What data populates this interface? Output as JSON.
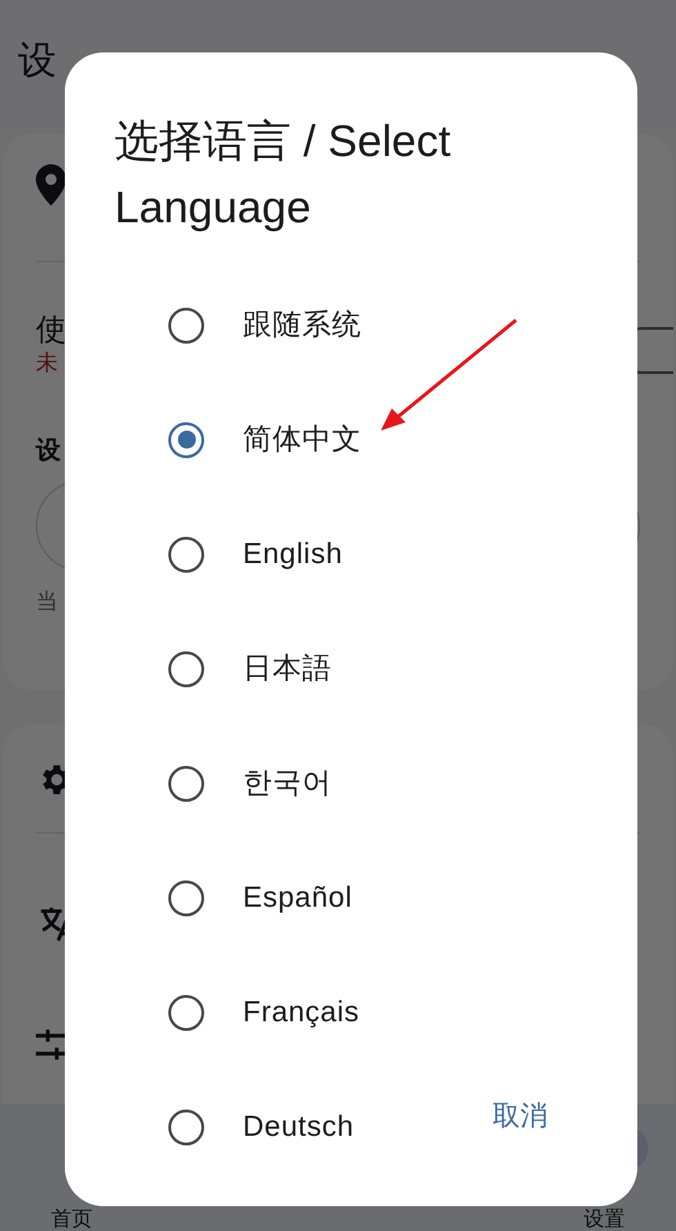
{
  "background": {
    "title": "设",
    "row_label": "使",
    "status_text": "未",
    "toggle_on": false,
    "section_label": "设",
    "current_text": "当",
    "nav_items": [
      {
        "label": "首页",
        "selected": false
      },
      {
        "label": "设置",
        "selected": true
      }
    ]
  },
  "dialog": {
    "title": "选择语言 / Select Language",
    "options": [
      {
        "label": "跟随系统",
        "selected": false
      },
      {
        "label": "简体中文",
        "selected": true
      },
      {
        "label": "English",
        "selected": false
      },
      {
        "label": "日本語",
        "selected": false
      },
      {
        "label": "한국어",
        "selected": false
      },
      {
        "label": "Español",
        "selected": false
      },
      {
        "label": "Français",
        "selected": false
      },
      {
        "label": "Deutsch",
        "selected": false
      }
    ],
    "cancel": "取消"
  }
}
